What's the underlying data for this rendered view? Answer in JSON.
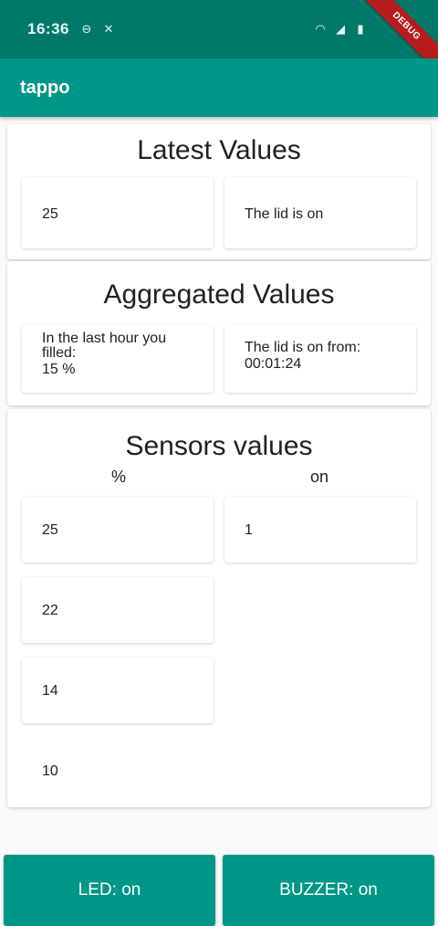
{
  "status_bar": {
    "time": "16:36",
    "left_icons": [
      "do-not-disturb-icon",
      "wrench-icon"
    ],
    "right_icons": [
      "wifi-icon",
      "signal-icon",
      "battery-icon"
    ]
  },
  "debug_banner": "DEBUG",
  "app_bar": {
    "title": "tappo"
  },
  "latest": {
    "title": "Latest Values",
    "fill_value": "25",
    "lid_status": "The lid is on"
  },
  "aggregated": {
    "title": "Aggregated Values",
    "filled_text_1": "In the last hour you",
    "filled_text_2": "filled:",
    "filled_value": "15 %",
    "lid_text": "The lid is on from:",
    "lid_duration": "00:01:24"
  },
  "sensors": {
    "title": "Sensors values",
    "col_percent": "%",
    "col_on": "on",
    "percent_values": [
      "25",
      "22",
      "14",
      "10"
    ],
    "on_values": [
      "1"
    ]
  },
  "buttons": {
    "led": "LED: on",
    "buzzer": "BUZZER: on"
  },
  "colors": {
    "primary": "#009688",
    "primary_dark": "#00796b",
    "debug": "#b71c1c"
  }
}
